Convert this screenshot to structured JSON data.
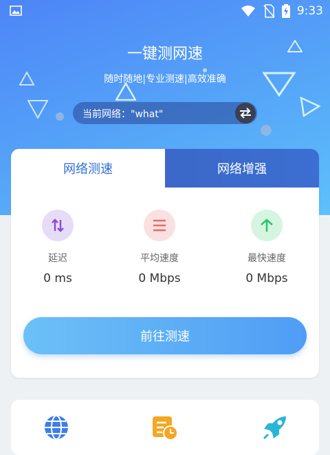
{
  "status_bar": {
    "time": "9:33"
  },
  "hero": {
    "title": "一键测网速",
    "subtitle": "随时随地|专业测速|高效准确",
    "network_label": "当前网络：\"what\""
  },
  "tabs": [
    {
      "label": "网络测速"
    },
    {
      "label": "网络增强"
    }
  ],
  "metrics": [
    {
      "label": "延迟",
      "value": "0 ms",
      "icon": "up-down-arrows-icon",
      "color": "#8a4cd1"
    },
    {
      "label": "平均速度",
      "value": "0 Mbps",
      "icon": "hamburger-lines-icon",
      "color": "#e86a6a"
    },
    {
      "label": "最快速度",
      "value": "0 Mbps",
      "icon": "arrow-up-icon",
      "color": "#2ec46a"
    }
  ],
  "start_button": {
    "label": "前往测速"
  },
  "tools": [
    {
      "icon": "globe-icon"
    },
    {
      "icon": "schedule-clock-icon"
    },
    {
      "icon": "rocket-icon"
    }
  ],
  "colors": {
    "accent": "#2f6fd6",
    "hero": "#4d85f7",
    "button": "#5aa9f6"
  }
}
